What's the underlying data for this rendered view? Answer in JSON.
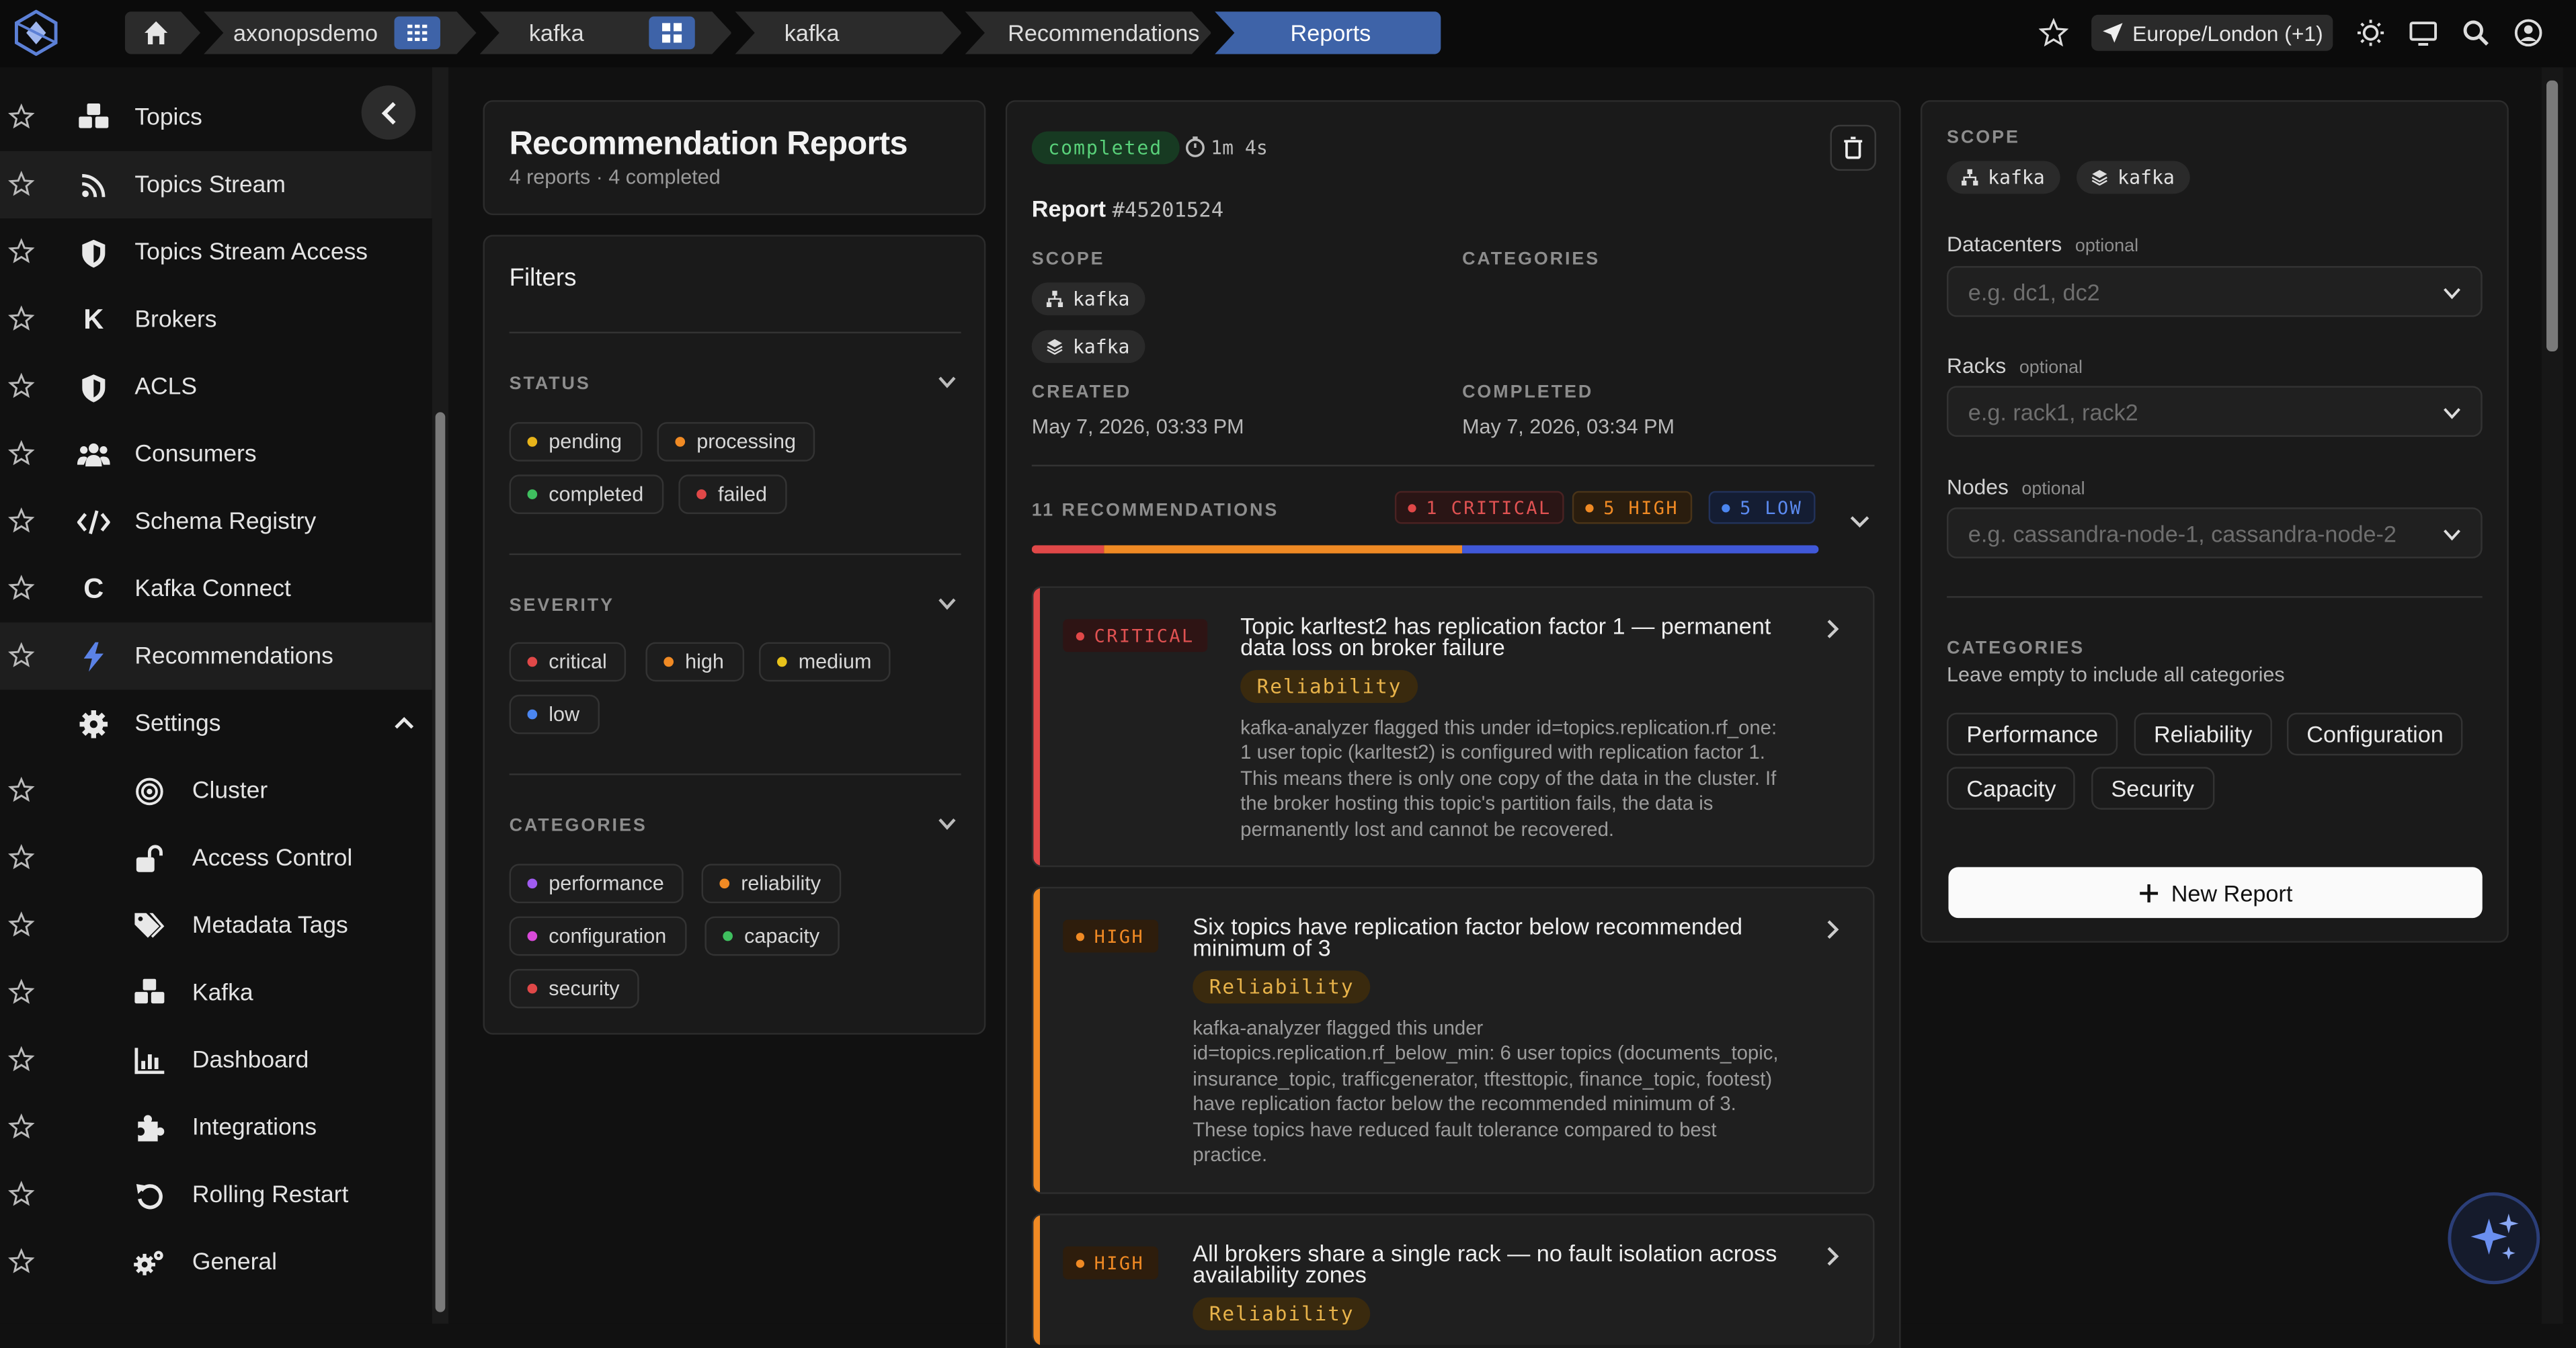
{
  "topbar": {
    "crumbs": [
      "axonopsdemo",
      "kafka",
      "kafka",
      "Recommendations",
      "Reports"
    ],
    "timezone": "Europe/London (+1)"
  },
  "sidebar": {
    "items": [
      {
        "label": "Topics",
        "icon": "cubes-icon"
      },
      {
        "label": "Topics Stream",
        "icon": "rss-icon"
      },
      {
        "label": "Topics Stream Access",
        "icon": "shield-icon"
      },
      {
        "label": "Brokers",
        "icon": "k-icon"
      },
      {
        "label": "ACLS",
        "icon": "shield-icon"
      },
      {
        "label": "Consumers",
        "icon": "users-icon"
      },
      {
        "label": "Schema Registry",
        "icon": "code-icon"
      },
      {
        "label": "Kafka Connect",
        "icon": "c-icon"
      },
      {
        "label": "Recommendations",
        "icon": "bolt-icon"
      },
      {
        "label": "Settings",
        "icon": "gear-icon"
      }
    ],
    "settings_items": [
      {
        "label": "Cluster",
        "icon": "target-icon"
      },
      {
        "label": "Access Control",
        "icon": "unlock-icon"
      },
      {
        "label": "Metadata Tags",
        "icon": "tags-icon"
      },
      {
        "label": "Kafka",
        "icon": "cubes-icon"
      },
      {
        "label": "Dashboard",
        "icon": "chart-icon"
      },
      {
        "label": "Integrations",
        "icon": "puzzle-icon"
      },
      {
        "label": "Rolling Restart",
        "icon": "restart-icon"
      },
      {
        "label": "General",
        "icon": "gears-icon"
      }
    ]
  },
  "reports": {
    "title": "Recommendation Reports",
    "subtitle": "4 reports · 4 completed"
  },
  "filters": {
    "title": "Filters",
    "status_label": "STATUS",
    "status": [
      {
        "label": "pending",
        "color": "#e8b41a"
      },
      {
        "label": "processing",
        "color": "#f08a24"
      },
      {
        "label": "completed",
        "color": "#3fbf5f"
      },
      {
        "label": "failed",
        "color": "#e04848"
      }
    ],
    "severity_label": "SEVERITY",
    "severity": [
      {
        "label": "critical",
        "color": "#e04848"
      },
      {
        "label": "high",
        "color": "#f08a24"
      },
      {
        "label": "medium",
        "color": "#e8c21a"
      },
      {
        "label": "low",
        "color": "#4b86f0"
      }
    ],
    "categories_label": "CATEGORIES",
    "categories": [
      {
        "label": "performance",
        "color": "#a05cf0"
      },
      {
        "label": "reliability",
        "color": "#f08a24"
      },
      {
        "label": "configuration",
        "color": "#d94ad9"
      },
      {
        "label": "capacity",
        "color": "#3fbf5f"
      },
      {
        "label": "security",
        "color": "#e04848"
      }
    ]
  },
  "report": {
    "status": "completed",
    "duration": "1m 4s",
    "title": "Report",
    "id": "#45201524",
    "scope_label": "SCOPE",
    "scope": [
      "kafka",
      "kafka"
    ],
    "categories_label": "CATEGORIES",
    "created_label": "CREATED",
    "created": "May 7, 2026, 03:33 PM",
    "completed_label": "COMPLETED",
    "completed": "May 7, 2026, 03:34 PM",
    "recommendations_label": "11 RECOMMENDATIONS",
    "badges": [
      "1 CRITICAL",
      "5 HIGH",
      "5 LOW"
    ],
    "severity_bar": {
      "critical": 1,
      "high": 5,
      "low": 5
    }
  },
  "recommendations": [
    {
      "severity": "CRITICAL",
      "title_1": "Topic karltest2 has replication factor 1 — permanent",
      "title_2": "data loss on broker failure",
      "category": "Reliability",
      "desc": [
        "kafka-analyzer flagged this under id=topics.replication.rf_one:",
        "1 user topic (karltest2) is configured with replication factor 1.",
        "This means there is only one copy of the data in the cluster. If",
        "the broker hosting this topic's partition fails, the data is",
        "permanently lost and cannot be recovered."
      ]
    },
    {
      "severity": "HIGH",
      "title_1": "Six topics have replication factor below recommended",
      "title_2": "minimum of 3",
      "category": "Reliability",
      "desc": [
        "kafka-analyzer flagged this under",
        "id=topics.replication.rf_below_min: 6 user topics (documents_topic,",
        "insurance_topic, trafficgenerator, tftesttopic, finance_topic, footest)",
        "have replication factor below the recommended minimum of 3.",
        "These topics have reduced fault tolerance compared to best",
        "practice."
      ]
    },
    {
      "severity": "HIGH",
      "title_1": "All brokers share a single rack — no fault isolation across",
      "title_2": "availability zones",
      "category": "Reliability",
      "desc": []
    }
  ],
  "new_report": {
    "scope_label": "SCOPE",
    "scope": [
      "kafka",
      "kafka"
    ],
    "datacenters_label": "Datacenters",
    "datacenters_placeholder": "e.g. dc1, dc2",
    "racks_label": "Racks",
    "racks_placeholder": "e.g. rack1, rack2",
    "nodes_label": "Nodes",
    "nodes_placeholder": "e.g. cassandra-node-1, cassandra-node-2",
    "optional": "optional",
    "categories_label": "CATEGORIES",
    "categories_help": "Leave empty to include all categories",
    "categories": [
      "Performance",
      "Reliability",
      "Configuration",
      "Capacity",
      "Security"
    ],
    "button": "New Report"
  }
}
